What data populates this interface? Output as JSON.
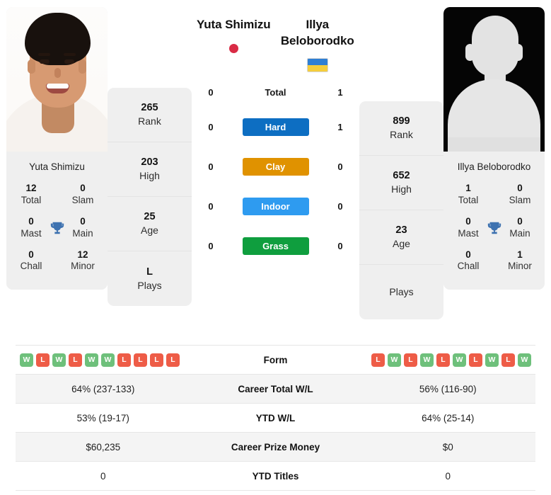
{
  "players": {
    "left": {
      "name": "Yuta Shimizu",
      "photo_caption": "Yuta Shimizu",
      "flag": "japan-flag",
      "titles": {
        "total": {
          "value": "12",
          "label": "Total"
        },
        "slam": {
          "value": "0",
          "label": "Slam"
        },
        "mast": {
          "value": "0",
          "label": "Mast"
        },
        "main": {
          "value": "0",
          "label": "Main"
        },
        "chall": {
          "value": "0",
          "label": "Chall"
        },
        "minor": {
          "value": "12",
          "label": "Minor"
        }
      },
      "rank": {
        "value": "265",
        "label": "Rank"
      },
      "high": {
        "value": "203",
        "label": "High"
      },
      "age": {
        "value": "25",
        "label": "Age"
      },
      "plays": {
        "value": "L",
        "label": "Plays"
      },
      "form": [
        "W",
        "L",
        "W",
        "L",
        "W",
        "W",
        "L",
        "L",
        "L",
        "L"
      ],
      "career_total_wl": "64% (237-133)",
      "ytd_wl": "53% (19-17)",
      "career_prize_money": "$60,235",
      "ytd_titles": "0"
    },
    "right": {
      "name": "Illya Beloborodko",
      "photo_caption": "Illya Beloborodko",
      "flag": "ukraine-flag",
      "titles": {
        "total": {
          "value": "1",
          "label": "Total"
        },
        "slam": {
          "value": "0",
          "label": "Slam"
        },
        "mast": {
          "value": "0",
          "label": "Mast"
        },
        "main": {
          "value": "0",
          "label": "Main"
        },
        "chall": {
          "value": "0",
          "label": "Chall"
        },
        "minor": {
          "value": "1",
          "label": "Minor"
        }
      },
      "rank": {
        "value": "899",
        "label": "Rank"
      },
      "high": {
        "value": "652",
        "label": "High"
      },
      "age": {
        "value": "23",
        "label": "Age"
      },
      "plays": {
        "value": "",
        "label": "Plays"
      },
      "form": [
        "L",
        "W",
        "L",
        "W",
        "L",
        "W",
        "L",
        "W",
        "L",
        "W"
      ],
      "career_total_wl": "56% (116-90)",
      "ytd_wl": "64% (25-14)",
      "career_prize_money": "$0",
      "ytd_titles": "0"
    }
  },
  "head_to_head": [
    {
      "label": "Total",
      "left": "0",
      "right": "1",
      "style": "plain",
      "color": ""
    },
    {
      "label": "Hard",
      "left": "0",
      "right": "1",
      "style": "pill",
      "color": "#0d6ec2"
    },
    {
      "label": "Clay",
      "left": "0",
      "right": "0",
      "style": "pill",
      "color": "#e09200"
    },
    {
      "label": "Indoor",
      "left": "0",
      "right": "0",
      "style": "pill",
      "color": "#2e9bf0"
    },
    {
      "label": "Grass",
      "left": "0",
      "right": "0",
      "style": "pill",
      "color": "#0f9e3e"
    }
  ],
  "stats_table": [
    {
      "label": "Form",
      "left": "",
      "right": "",
      "type": "form"
    },
    {
      "label": "Career Total W/L",
      "left": "64% (237-133)",
      "right": "56% (116-90)",
      "type": "text"
    },
    {
      "label": "YTD W/L",
      "left": "53% (19-17)",
      "right": "64% (25-14)",
      "type": "text"
    },
    {
      "label": "Career Prize Money",
      "left": "$60,235",
      "right": "$0",
      "type": "text"
    },
    {
      "label": "YTD Titles",
      "left": "0",
      "right": "0",
      "type": "text"
    }
  ],
  "colors": {
    "win": "#6ec07b",
    "loss": "#ee5c47",
    "hard": "#0d6ec2",
    "clay": "#e09200",
    "indoor": "#2e9bf0",
    "grass": "#0f9e3e",
    "trophy": "#3e72b0",
    "panel": "#efefef"
  }
}
